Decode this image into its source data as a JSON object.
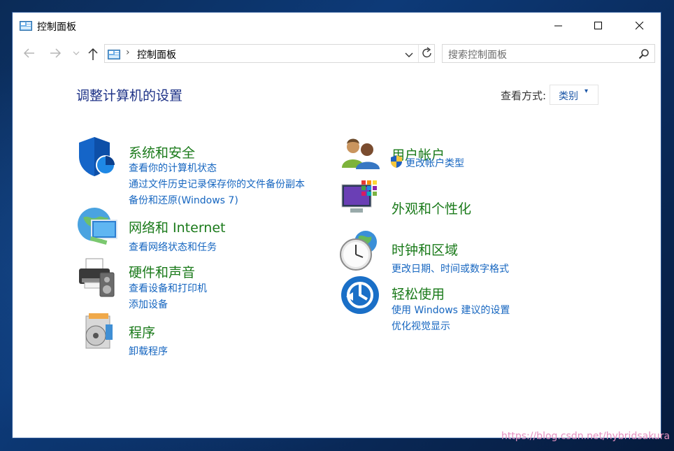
{
  "window": {
    "title": "控制面板"
  },
  "nav": {
    "address_text": "控制面板",
    "address_separator": "›",
    "search_placeholder": "搜索控制面板"
  },
  "heading": "调整计算机的设置",
  "view_by": {
    "label": "查看方式:",
    "value": "类别"
  },
  "categories": [
    {
      "title": "系统和安全",
      "links": [
        "查看你的计算机状态",
        "通过文件历史记录保存你的文件备份副本",
        "备份和还原(Windows 7)"
      ],
      "icon": "shield-icon"
    },
    {
      "title": "网络和 Internet",
      "links": [
        "查看网络状态和任务"
      ],
      "icon": "network-globe-icon"
    },
    {
      "title": "硬件和声音",
      "links": [
        "查看设备和打印机",
        "添加设备"
      ],
      "icon": "printer-speaker-icon"
    },
    {
      "title": "程序",
      "links": [
        "卸载程序"
      ],
      "icon": "programs-disc-icon"
    },
    {
      "title": "用户帐户",
      "links": [
        "更改帐户类型"
      ],
      "icon": "users-icon"
    },
    {
      "title": "外观和个性化",
      "links": [],
      "icon": "monitor-palette-icon"
    },
    {
      "title": "时钟和区域",
      "links": [
        "更改日期、时间或数字格式"
      ],
      "icon": "clock-globe-icon"
    },
    {
      "title": "轻松使用",
      "links": [
        "使用 Windows 建议的设置",
        "优化视觉显示"
      ],
      "icon": "ease-of-access-icon"
    }
  ],
  "watermark": "https://blog.csdn.net/hybridsakura",
  "colors": {
    "category_title": "#1a7a1a",
    "link": "#1666c0",
    "heading": "#1e3287",
    "desktop": "#0d3a78"
  }
}
